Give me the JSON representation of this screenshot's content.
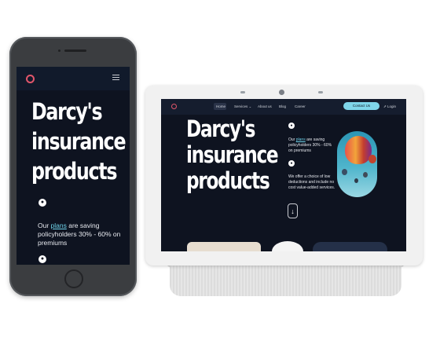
{
  "hero": {
    "title_line1": "Darcy's",
    "title_line2": "insurance",
    "title_line3": "products",
    "text_prefix": "Our ",
    "text_link": "plans",
    "text_suffix": " are saving policyholders 30% - 60% on premiums",
    "tablet_text_suffix": " are saving policyholders 30% - 60% on premiums",
    "text2": "We offer a choice of low deductions and include no cost value-added services."
  },
  "nav": {
    "home": "Home",
    "services": "Services ⌄",
    "about": "About us",
    "blog": "Blog",
    "career": "Career",
    "cta": "Contact Us",
    "login": "Login"
  },
  "icons": {
    "logo": "ring-logo-icon",
    "menu": "hamburger-menu-icon",
    "badge": "bullet-circle-icon",
    "arrow": "arrow-down-icon",
    "login": "login-arrow-icon"
  },
  "colors": {
    "background": "#0e1320",
    "accent": "#7fd6ea",
    "logo": "#e2566b"
  }
}
